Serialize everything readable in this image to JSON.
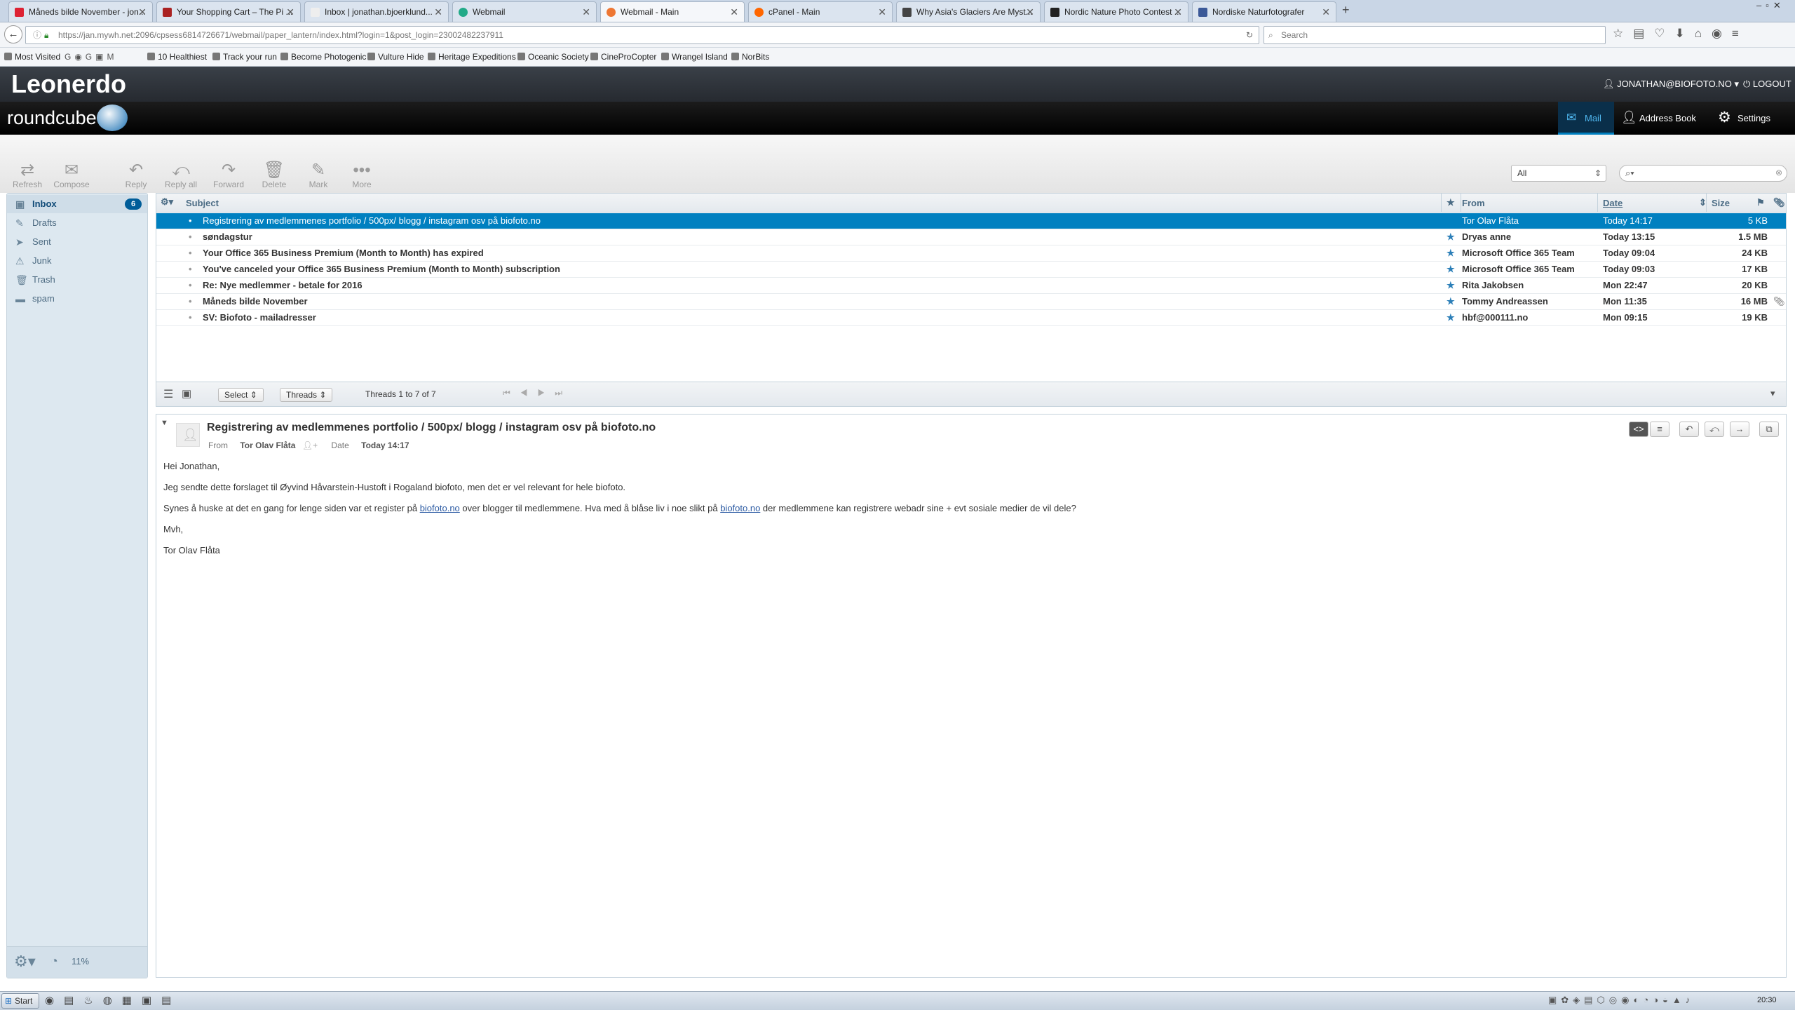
{
  "browser": {
    "tabs": [
      {
        "title": "Måneds bilde November - jon...",
        "color": "#d23"
      },
      {
        "title": "Your Shopping Cart – The Pi ...",
        "color": "#a22"
      },
      {
        "title": "Inbox | jonathan.bjoerklund...",
        "color": "#ddd"
      },
      {
        "title": "Webmail",
        "color": "#2a8"
      },
      {
        "title": "Webmail - Main",
        "color": "#e73"
      },
      {
        "title": "cPanel - Main",
        "color": "#f60"
      },
      {
        "title": "Why Asia's Glaciers Are Myst...",
        "color": "#444"
      },
      {
        "title": "Nordic Nature Photo Contest ...",
        "color": "#222"
      },
      {
        "title": "Nordiske Naturfotografer",
        "color": "#3b5998"
      }
    ],
    "url": "https://jan.mywh.net:2096/cpsess6814726671/webmail/paper_lantern/index.html?login=1&post_login=23002482237911",
    "search_placeholder": "Search",
    "bookmarks": [
      "Most Visited",
      "10 Healthiest",
      "Track your run",
      "Become Photogenic",
      "Vulture Hide",
      "Heritage Expeditions",
      "Oceanic Society",
      "CineProCopter",
      "Wrangel Island",
      "NorBits"
    ]
  },
  "app": {
    "host_name": "Leonerdo",
    "brand": "roundcube",
    "user": "JONATHAN@BIOFOTO.NO",
    "logout": "LOGOUT",
    "nav": {
      "mail": "Mail",
      "address_book": "Address Book",
      "settings": "Settings"
    }
  },
  "toolbar": {
    "refresh": "Refresh",
    "compose": "Compose",
    "reply": "Reply",
    "reply_all": "Reply all",
    "forward": "Forward",
    "delete": "Delete",
    "mark": "Mark",
    "more": "More",
    "filter": "All"
  },
  "folders": [
    {
      "name": "Inbox",
      "count": "6",
      "icon": "inbox-icon"
    },
    {
      "name": "Drafts",
      "icon": "pencil-icon"
    },
    {
      "name": "Sent",
      "icon": "sent-icon"
    },
    {
      "name": "Junk",
      "icon": "junk-icon"
    },
    {
      "name": "Trash",
      "icon": "trash-icon"
    },
    {
      "name": "spam",
      "icon": "folder-icon"
    }
  ],
  "quota": "11%",
  "list": {
    "headers": {
      "subject": "Subject",
      "from": "From",
      "date": "Date",
      "size": "Size"
    },
    "messages": [
      {
        "subject": "Registrering av medlemmenes portfolio / 500px/ blogg / instagram osv på biofoto.no",
        "from": "Tor Olav Flåta",
        "date": "Today 14:17",
        "size": "5 KB",
        "selected": true,
        "flagged": false,
        "attachment": false
      },
      {
        "subject": "søndagstur",
        "from": "Dryas anne",
        "date": "Today 13:15",
        "size": "1.5 MB",
        "flagged": true
      },
      {
        "subject": "Your Office 365 Business Premium (Month to Month) has expired",
        "from": "Microsoft Office 365 Team",
        "date": "Today 09:04",
        "size": "24 KB",
        "flagged": true
      },
      {
        "subject": "You've canceled your Office 365 Business Premium (Month to Month) subscription",
        "from": "Microsoft Office 365 Team",
        "date": "Today 09:03",
        "size": "17 KB",
        "flagged": true
      },
      {
        "subject": "Re: Nye medlemmer - betale for 2016",
        "from": "Rita Jakobsen",
        "date": "Mon 22:47",
        "size": "20 KB",
        "flagged": true
      },
      {
        "subject": "Måneds bilde November",
        "from": "Tommy Andreassen",
        "date": "Mon 11:35",
        "size": "16 MB",
        "flagged": true,
        "attachment": true
      },
      {
        "subject": "SV: Biofoto - mailadresser",
        "from": "hbf@000111.no",
        "date": "Mon 09:15",
        "size": "19 KB",
        "flagged": true
      }
    ],
    "footer": {
      "select": "Select",
      "threads": "Threads",
      "count": "Threads 1 to 7 of 7"
    }
  },
  "preview": {
    "subject": "Registrering av medlemmenes portfolio / 500px/ blogg / instagram osv på biofoto.no",
    "from_label": "From",
    "from": "Tor Olav Flåta",
    "date_label": "Date",
    "date": "Today 14:17",
    "greeting": "Hei Jonathan,",
    "p1": "Jeg sendte dette forslaget til Øyvind Håvarstein-Hustoft i Rogaland biofoto, men det er vel relevant for hele biofoto.",
    "p2a": "Synes å huske at det en gang for lenge siden var et register på ",
    "link1": "biofoto.no",
    "p2b": " over blogger til medlemmene. Hva med å blåse liv i noe slikt på ",
    "link2": "biofoto.no",
    "p2c": " der medlemmene kan registrere webadr sine + evt sosiale medier de vil dele?",
    "closing": "Mvh,",
    "signature": "Tor Olav Flåta"
  },
  "taskbar": {
    "start": "Start",
    "clock": "20:30"
  }
}
